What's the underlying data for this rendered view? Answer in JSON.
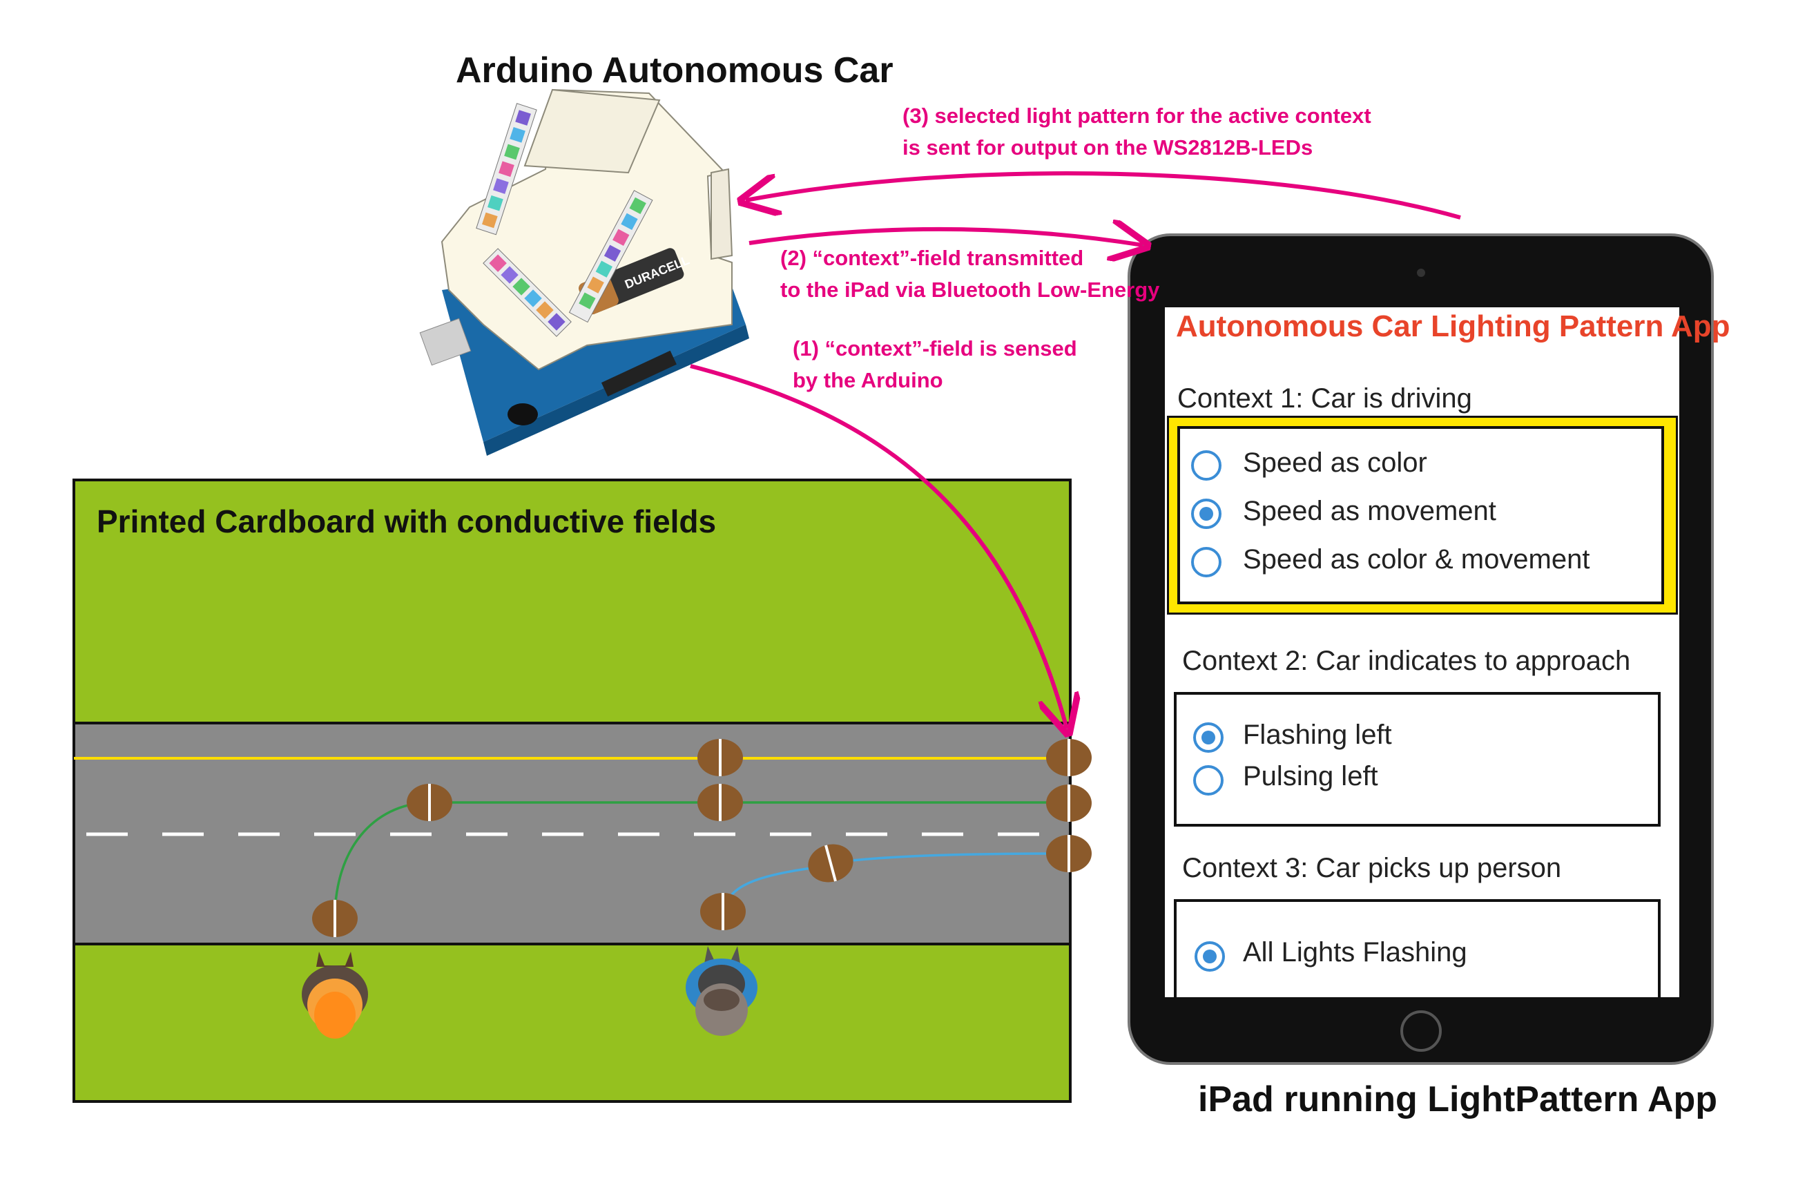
{
  "titles": {
    "car": "Arduino Autonomous Car",
    "cardboard": "Printed Cardboard with conductive fields",
    "ipad": "iPad running LightPattern App"
  },
  "arrows": {
    "step1": [
      "(1) “context”-field is sensed",
      "by the Arduino"
    ],
    "step2": [
      "(2) “context”-field transmitted",
      "to the iPad via Bluetooth Low-Energy"
    ],
    "step3": [
      "(3) selected light pattern for the active context",
      "is sent for output on the WS2812B-LEDs"
    ]
  },
  "battery_label": "DURACELL",
  "colors": {
    "grass": "#95c11f",
    "road": "#8a8a8a",
    "center_line": "#ffdd00",
    "arrow": "#e6007e",
    "highlight": "#ffe600",
    "radio": "#3a8dd6",
    "app_title": "#e8442a",
    "wire_green": "#2ea043",
    "wire_blue": "#45a8e0",
    "contact": "#8b5a2b"
  },
  "app": {
    "title": "Autonomous Car Lighting Pattern App",
    "contexts": [
      {
        "label": "Context 1: Car is driving",
        "active": true,
        "options": [
          {
            "label": "Speed as color",
            "selected": false
          },
          {
            "label": "Speed as movement",
            "selected": true
          },
          {
            "label": "Speed as color & movement",
            "selected": false
          }
        ]
      },
      {
        "label": "Context 2: Car indicates to approach",
        "active": false,
        "options": [
          {
            "label": "Flashing left",
            "selected": true
          },
          {
            "label": "Pulsing left",
            "selected": false
          }
        ]
      },
      {
        "label": "Context 3: Car picks up person",
        "active": false,
        "options": [
          {
            "label": "All Lights Flashing",
            "selected": true
          }
        ]
      }
    ]
  }
}
